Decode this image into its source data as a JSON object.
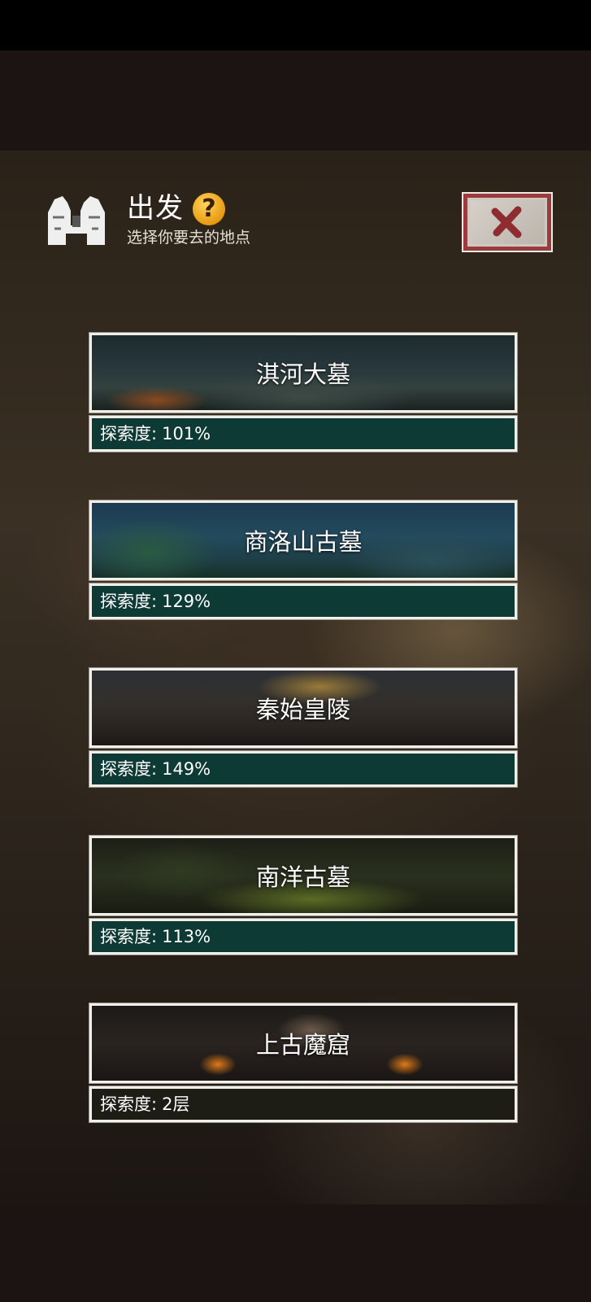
{
  "header": {
    "title": "出发",
    "subtitle": "选择你要去的地点"
  },
  "locations": [
    {
      "name": "淇河大墓",
      "progress_label": "探索度:",
      "progress_value": "101%"
    },
    {
      "name": "商洛山古墓",
      "progress_label": "探索度:",
      "progress_value": "129%"
    },
    {
      "name": "秦始皇陵",
      "progress_label": "探索度:",
      "progress_value": "149%"
    },
    {
      "name": "南洋古墓",
      "progress_label": "探索度:",
      "progress_value": "113%"
    },
    {
      "name": "上古魔窟",
      "progress_label": "探索度:",
      "progress_value": "2层"
    }
  ]
}
